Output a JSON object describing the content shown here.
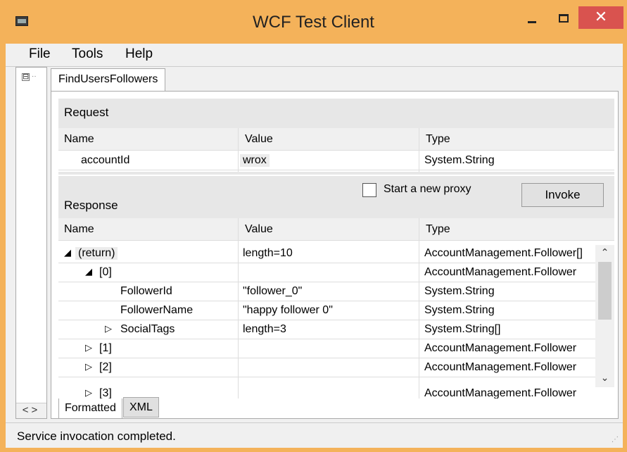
{
  "window": {
    "title": "WCF Test Client",
    "close_glyph": "✕",
    "accent_color": "#f4b25a",
    "close_color": "#d9534f"
  },
  "menu": {
    "file": "File",
    "tools": "Tools",
    "help": "Help"
  },
  "tree": {
    "expander": "⊟",
    "dots": "··",
    "scroll_arrows": "<>"
  },
  "tab": {
    "label": "FindUsersFollowers"
  },
  "request": {
    "title": "Request",
    "headers": [
      "Name",
      "Value",
      "Type"
    ],
    "rows": [
      {
        "name": "accountId",
        "value": "wrox",
        "type": "System.String"
      }
    ]
  },
  "response": {
    "title": "Response",
    "start_proxy_label": "Start a new proxy",
    "start_proxy_checked": false,
    "invoke_label": "Invoke",
    "headers": [
      "Name",
      "Value",
      "Type"
    ],
    "rows": [
      {
        "expander": "◢",
        "name": "(return)",
        "value": "length=10",
        "type": "AccountManagement.Follower[]"
      },
      {
        "expander": "◢",
        "name": "[0]",
        "value": "",
        "type": "AccountManagement.Follower"
      },
      {
        "expander": "",
        "name": "FollowerId",
        "value": "\"follower_0\"",
        "type": "System.String"
      },
      {
        "expander": "",
        "name": "FollowerName",
        "value": "\"happy follower 0\"",
        "type": "System.String"
      },
      {
        "expander": "▷",
        "name": "SocialTags",
        "value": "length=3",
        "type": "System.String[]"
      },
      {
        "expander": "▷",
        "name": "[1]",
        "value": "",
        "type": "AccountManagement.Follower"
      },
      {
        "expander": "▷",
        "name": "[2]",
        "value": "",
        "type": "AccountManagement.Follower"
      },
      {
        "expander": "▷",
        "name": "[3]",
        "value": "",
        "type": "AccountManagement.Follower"
      }
    ],
    "scroll_up": "⌃",
    "scroll_down": "⌄"
  },
  "bottom_tabs": {
    "formatted": "Formatted",
    "xml": "XML"
  },
  "status": {
    "text": "Service invocation completed.",
    "grip": "⋰"
  }
}
